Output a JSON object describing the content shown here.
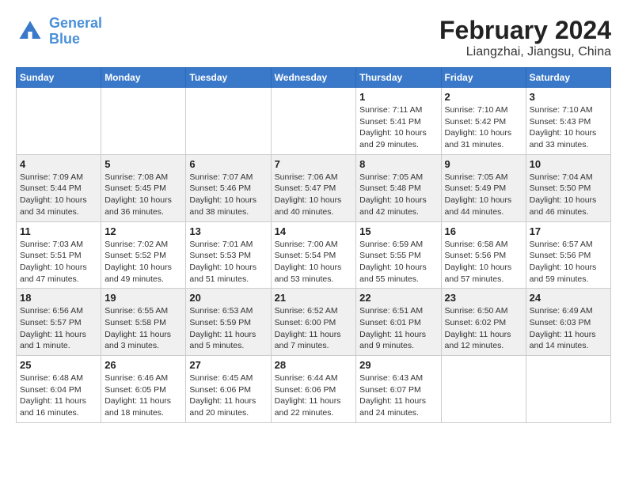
{
  "logo": {
    "line1": "General",
    "line2": "Blue"
  },
  "title": "February 2024",
  "subtitle": "Liangzhai, Jiangsu, China",
  "days_of_week": [
    "Sunday",
    "Monday",
    "Tuesday",
    "Wednesday",
    "Thursday",
    "Friday",
    "Saturday"
  ],
  "weeks": [
    [
      {
        "day": "",
        "info": ""
      },
      {
        "day": "",
        "info": ""
      },
      {
        "day": "",
        "info": ""
      },
      {
        "day": "",
        "info": ""
      },
      {
        "day": "1",
        "info": "Sunrise: 7:11 AM\nSunset: 5:41 PM\nDaylight: 10 hours\nand 29 minutes."
      },
      {
        "day": "2",
        "info": "Sunrise: 7:10 AM\nSunset: 5:42 PM\nDaylight: 10 hours\nand 31 minutes."
      },
      {
        "day": "3",
        "info": "Sunrise: 7:10 AM\nSunset: 5:43 PM\nDaylight: 10 hours\nand 33 minutes."
      }
    ],
    [
      {
        "day": "4",
        "info": "Sunrise: 7:09 AM\nSunset: 5:44 PM\nDaylight: 10 hours\nand 34 minutes."
      },
      {
        "day": "5",
        "info": "Sunrise: 7:08 AM\nSunset: 5:45 PM\nDaylight: 10 hours\nand 36 minutes."
      },
      {
        "day": "6",
        "info": "Sunrise: 7:07 AM\nSunset: 5:46 PM\nDaylight: 10 hours\nand 38 minutes."
      },
      {
        "day": "7",
        "info": "Sunrise: 7:06 AM\nSunset: 5:47 PM\nDaylight: 10 hours\nand 40 minutes."
      },
      {
        "day": "8",
        "info": "Sunrise: 7:05 AM\nSunset: 5:48 PM\nDaylight: 10 hours\nand 42 minutes."
      },
      {
        "day": "9",
        "info": "Sunrise: 7:05 AM\nSunset: 5:49 PM\nDaylight: 10 hours\nand 44 minutes."
      },
      {
        "day": "10",
        "info": "Sunrise: 7:04 AM\nSunset: 5:50 PM\nDaylight: 10 hours\nand 46 minutes."
      }
    ],
    [
      {
        "day": "11",
        "info": "Sunrise: 7:03 AM\nSunset: 5:51 PM\nDaylight: 10 hours\nand 47 minutes."
      },
      {
        "day": "12",
        "info": "Sunrise: 7:02 AM\nSunset: 5:52 PM\nDaylight: 10 hours\nand 49 minutes."
      },
      {
        "day": "13",
        "info": "Sunrise: 7:01 AM\nSunset: 5:53 PM\nDaylight: 10 hours\nand 51 minutes."
      },
      {
        "day": "14",
        "info": "Sunrise: 7:00 AM\nSunset: 5:54 PM\nDaylight: 10 hours\nand 53 minutes."
      },
      {
        "day": "15",
        "info": "Sunrise: 6:59 AM\nSunset: 5:55 PM\nDaylight: 10 hours\nand 55 minutes."
      },
      {
        "day": "16",
        "info": "Sunrise: 6:58 AM\nSunset: 5:56 PM\nDaylight: 10 hours\nand 57 minutes."
      },
      {
        "day": "17",
        "info": "Sunrise: 6:57 AM\nSunset: 5:56 PM\nDaylight: 10 hours\nand 59 minutes."
      }
    ],
    [
      {
        "day": "18",
        "info": "Sunrise: 6:56 AM\nSunset: 5:57 PM\nDaylight: 11 hours\nand 1 minute."
      },
      {
        "day": "19",
        "info": "Sunrise: 6:55 AM\nSunset: 5:58 PM\nDaylight: 11 hours\nand 3 minutes."
      },
      {
        "day": "20",
        "info": "Sunrise: 6:53 AM\nSunset: 5:59 PM\nDaylight: 11 hours\nand 5 minutes."
      },
      {
        "day": "21",
        "info": "Sunrise: 6:52 AM\nSunset: 6:00 PM\nDaylight: 11 hours\nand 7 minutes."
      },
      {
        "day": "22",
        "info": "Sunrise: 6:51 AM\nSunset: 6:01 PM\nDaylight: 11 hours\nand 9 minutes."
      },
      {
        "day": "23",
        "info": "Sunrise: 6:50 AM\nSunset: 6:02 PM\nDaylight: 11 hours\nand 12 minutes."
      },
      {
        "day": "24",
        "info": "Sunrise: 6:49 AM\nSunset: 6:03 PM\nDaylight: 11 hours\nand 14 minutes."
      }
    ],
    [
      {
        "day": "25",
        "info": "Sunrise: 6:48 AM\nSunset: 6:04 PM\nDaylight: 11 hours\nand 16 minutes."
      },
      {
        "day": "26",
        "info": "Sunrise: 6:46 AM\nSunset: 6:05 PM\nDaylight: 11 hours\nand 18 minutes."
      },
      {
        "day": "27",
        "info": "Sunrise: 6:45 AM\nSunset: 6:06 PM\nDaylight: 11 hours\nand 20 minutes."
      },
      {
        "day": "28",
        "info": "Sunrise: 6:44 AM\nSunset: 6:06 PM\nDaylight: 11 hours\nand 22 minutes."
      },
      {
        "day": "29",
        "info": "Sunrise: 6:43 AM\nSunset: 6:07 PM\nDaylight: 11 hours\nand 24 minutes."
      },
      {
        "day": "",
        "info": ""
      },
      {
        "day": "",
        "info": ""
      }
    ]
  ]
}
